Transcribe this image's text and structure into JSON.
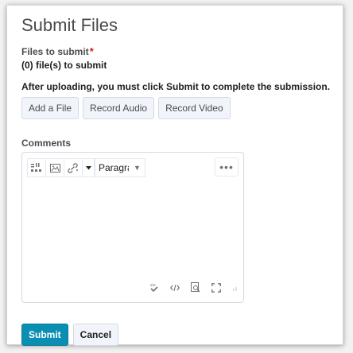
{
  "dialog": {
    "title": "Submit Files",
    "files_label": "Files to submit",
    "required_mark": "*",
    "file_count": "(0) file(s) to submit",
    "notice": "After uploading, you must click Submit to complete the submission.",
    "buttons": {
      "add_file": "Add a File",
      "record_audio": "Record Audio",
      "record_video": "Record Video"
    },
    "comments_label": "Comments",
    "editor": {
      "paragraph_select": "Paragraph",
      "more_label": "•••",
      "toolbar_icons": [
        "insert-stuff-icon",
        "insert-image-icon",
        "insert-link-icon",
        "chevron-down-icon"
      ],
      "footer_icons": [
        "spellcheck-icon",
        "source-code-icon",
        "preview-icon",
        "fullscreen-icon",
        "resize-handle-icon"
      ]
    },
    "actions": {
      "submit": "Submit",
      "cancel": "Cancel"
    }
  },
  "colors": {
    "primary": "#0a8fb3",
    "required": "#cd2026"
  }
}
